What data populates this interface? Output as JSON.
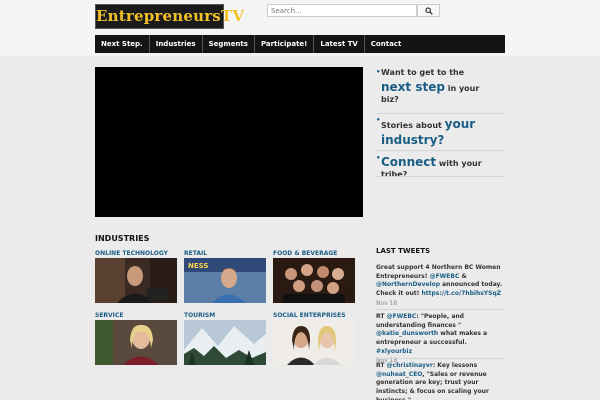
{
  "logo": {
    "text": "EntrepreneursTV"
  },
  "search": {
    "placeholder": "Search..."
  },
  "nav": {
    "items": [
      "Next Step.",
      "Industries",
      "Segments",
      "Participate!",
      "Latest TV",
      "Contact"
    ]
  },
  "promos": [
    {
      "pre": "Want to get to the ",
      "big": "next step",
      "post": " in your biz?"
    },
    {
      "pre": "Stories about ",
      "big": "your industry?",
      "post": ""
    },
    {
      "pre": "",
      "big": "Connect",
      "post": " with your tribe?"
    }
  ],
  "industries": {
    "title": "INDUSTRIES",
    "items": [
      {
        "label": "ONLINE TECHNOLOGY"
      },
      {
        "label": "RETAIL"
      },
      {
        "label": "FOOD & BEVERAGE"
      },
      {
        "label": "SERVICE"
      },
      {
        "label": "TOURISM"
      },
      {
        "label": "SOCIAL ENTERPRISES"
      }
    ]
  },
  "tweets": {
    "title": "LAST TWEETS",
    "items": [
      {
        "text": "Great support 4 Northern BC Women Entrepreneurs! ",
        "m1": "@FWEBC",
        "t2": " & ",
        "m2": "@NorthernDevelop",
        "t3": " announced today. Check it out! ",
        "link": "https://t.co/7hbihsYSqZ",
        "date": "Nov 18"
      },
      {
        "text": "RT ",
        "m1": "@FWEBC",
        "t2": ": \"People, and understanding finances \" ",
        "m2": "@katie_dunsworth",
        "t3": " what makes a entrepreneur a successful. ",
        "link": "#xlyourbiz",
        "date": "Nov 18"
      },
      {
        "text": "RT ",
        "m1": "@christinayvr",
        "t2": ": Key lessons ",
        "m2": "@nuheat_CEO",
        "t3": ", \"Sales or revenue generation are key; trust your instincts; & focus on scaling your business.\"",
        "link": "",
        "date": ""
      }
    ]
  }
}
